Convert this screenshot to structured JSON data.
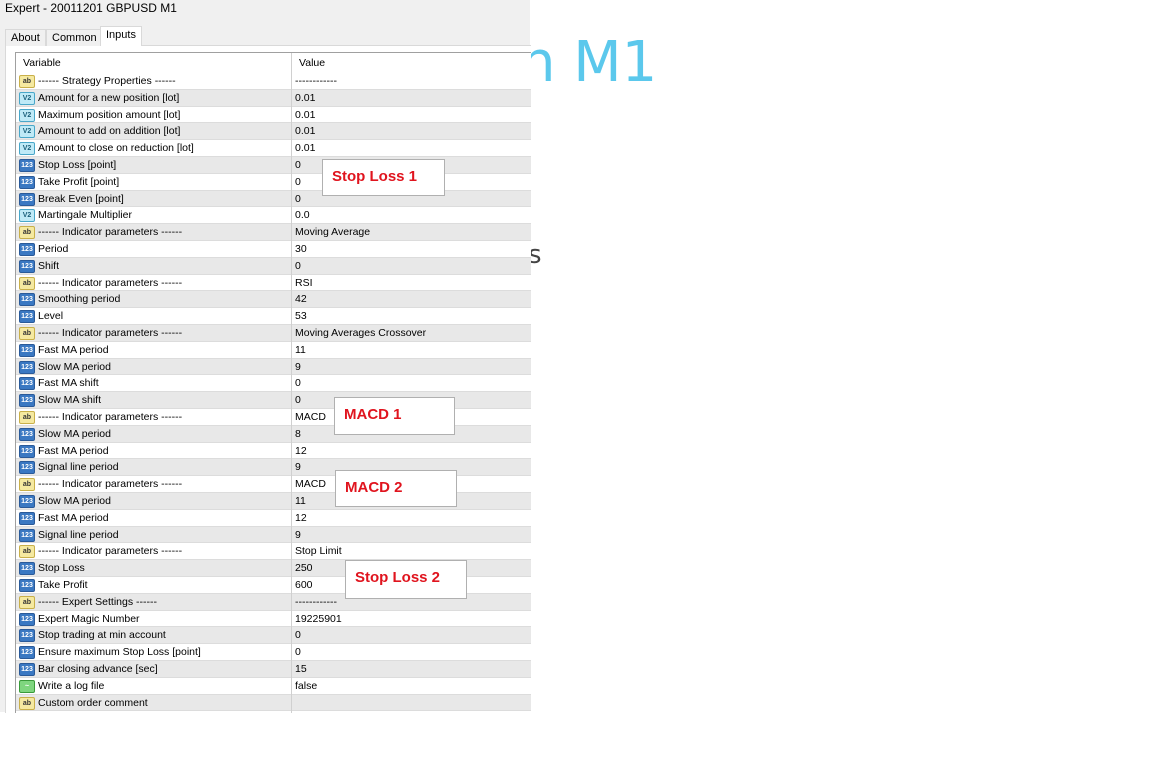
{
  "window": {
    "title": "Expert - 20011201 GBPUSD M1"
  },
  "background": {
    "text1": "n M1",
    "text2": "s"
  },
  "tabs": [
    {
      "label": "About"
    },
    {
      "label": "Common"
    },
    {
      "label": "Inputs",
      "active": true
    }
  ],
  "grid": {
    "headers": {
      "variable": "Variable",
      "value": "Value"
    },
    "rows": [
      {
        "type": "ab",
        "name": "------ Strategy Properties ------",
        "value": "------------"
      },
      {
        "type": "dbl",
        "name": "Amount for a new position [lot]",
        "value": "0.01"
      },
      {
        "type": "dbl",
        "name": "Maximum position amount [lot]",
        "value": "0.01"
      },
      {
        "type": "dbl",
        "name": "Amount to add on addition [lot]",
        "value": "0.01"
      },
      {
        "type": "dbl",
        "name": "Amount to close on reduction [lot]",
        "value": "0.01"
      },
      {
        "type": "int",
        "name": "Stop Loss [point]",
        "value": "0"
      },
      {
        "type": "int",
        "name": "Take Profit [point]",
        "value": "0"
      },
      {
        "type": "int",
        "name": "Break Even [point]",
        "value": "0"
      },
      {
        "type": "dbl",
        "name": "Martingale Multiplier",
        "value": "0.0"
      },
      {
        "type": "ab",
        "name": "------ Indicator parameters ------",
        "value": "Moving Average"
      },
      {
        "type": "int",
        "name": "Period",
        "value": "30"
      },
      {
        "type": "int",
        "name": "Shift",
        "value": "0"
      },
      {
        "type": "ab",
        "name": "------ Indicator parameters ------",
        "value": "RSI"
      },
      {
        "type": "int",
        "name": "Smoothing period",
        "value": "42"
      },
      {
        "type": "int",
        "name": "Level",
        "value": "53"
      },
      {
        "type": "ab",
        "name": "------ Indicator parameters ------",
        "value": "Moving Averages Crossover"
      },
      {
        "type": "int",
        "name": "Fast MA period",
        "value": "11"
      },
      {
        "type": "int",
        "name": "Slow MA period",
        "value": "9"
      },
      {
        "type": "int",
        "name": "Fast MA shift",
        "value": "0"
      },
      {
        "type": "int",
        "name": "Slow MA shift",
        "value": "0"
      },
      {
        "type": "ab",
        "name": "------ Indicator parameters ------",
        "value": "MACD"
      },
      {
        "type": "int",
        "name": "Slow MA period",
        "value": "8"
      },
      {
        "type": "int",
        "name": "Fast MA period",
        "value": "12"
      },
      {
        "type": "int",
        "name": "Signal line period",
        "value": "9"
      },
      {
        "type": "ab",
        "name": "------ Indicator parameters ------",
        "value": "MACD"
      },
      {
        "type": "int",
        "name": "Slow MA period",
        "value": "11"
      },
      {
        "type": "int",
        "name": "Fast MA period",
        "value": "12"
      },
      {
        "type": "int",
        "name": "Signal line period",
        "value": "9"
      },
      {
        "type": "ab",
        "name": "------ Indicator parameters ------",
        "value": "Stop Limit"
      },
      {
        "type": "int",
        "name": "Stop Loss",
        "value": "250"
      },
      {
        "type": "int",
        "name": "Take Profit",
        "value": "600"
      },
      {
        "type": "ab",
        "name": "------ Expert Settings ------",
        "value": "------------"
      },
      {
        "type": "int",
        "name": "Expert Magic Number",
        "value": "19225901"
      },
      {
        "type": "int",
        "name": "Stop trading at min account",
        "value": "0"
      },
      {
        "type": "int",
        "name": "Ensure maximum Stop Loss [point]",
        "value": "0"
      },
      {
        "type": "int",
        "name": "Bar closing advance [sec]",
        "value": "15"
      },
      {
        "type": "bool",
        "name": "Write a log file",
        "value": "false"
      },
      {
        "type": "ab",
        "name": "Custom order comment",
        "value": ""
      }
    ]
  },
  "icons": {
    "ab": "ab",
    "dbl": "V2",
    "int": "123",
    "bool": "~"
  },
  "annotations": [
    {
      "text": "Stop Loss 1"
    },
    {
      "text": "MACD 1"
    },
    {
      "text": "MACD 2"
    },
    {
      "text": "Stop Loss 2"
    }
  ],
  "colors": {
    "annotation": "#e0141e",
    "background_text": "#5bc8ec"
  }
}
